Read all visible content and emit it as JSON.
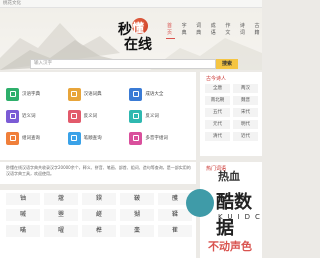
{
  "topbar": {
    "link": "桃花文化"
  },
  "nav": [
    "首页",
    "字典",
    "词典",
    "成语",
    "作文",
    "诗词",
    "古籍"
  ],
  "logo": {
    "char1": "秒",
    "char2": "懂",
    "chars": "在线"
  },
  "search": {
    "placeholder": "输入汉字",
    "button": "搜索"
  },
  "categories": [
    {
      "label": "汉语字典",
      "color": "#2eaf6b"
    },
    {
      "label": "汉语词典",
      "color": "#e8a53a"
    },
    {
      "label": "成语大全",
      "color": "#3a7bd5"
    },
    {
      "label": "近义词",
      "color": "#7b5bd5"
    },
    {
      "label": "反义词",
      "color": "#e25a6b"
    },
    {
      "label": "反义词",
      "color": "#2eb8b0"
    },
    {
      "label": "组词查询",
      "color": "#f07f3a"
    },
    {
      "label": "笔顺查询",
      "color": "#3aa2e8"
    },
    {
      "label": "多音字组词",
      "color": "#d94f9c"
    }
  ],
  "right_panel": {
    "title": "古今诗人",
    "items": [
      "全唐",
      "两汉",
      "南北朝",
      "魏晋",
      "五代",
      "宋代",
      "元代",
      "明代",
      "清代",
      "近代"
    ]
  },
  "right_panel2": {
    "title": "热门词语"
  },
  "intro_text": "秒懂在线汉语字典共收录汉字20000余个，释义、拼音、笔画、部首、组词、造句等查询，是一部实用的汉语字典工具，欢迎使用。",
  "chars": [
    "铀",
    "蔻",
    "鍨",
    "鞁",
    "雘",
    "嘁",
    "瞾",
    "鹾",
    "猢",
    "鞣",
    "暪",
    "嚁",
    "榫",
    "稾",
    "萑"
  ],
  "overlay": {
    "text1": "热血",
    "text2": "不动声色"
  },
  "watermark": {
    "cn": "酷数据",
    "en": "KUIDC"
  }
}
